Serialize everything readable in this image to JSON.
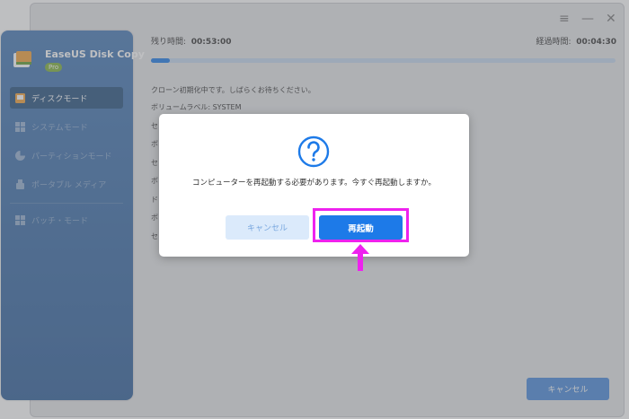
{
  "app": {
    "name": "EaseUS Disk Copy",
    "edition": "Pro"
  },
  "window_controls": {
    "menu": "≡",
    "minimize": "—",
    "close": "✕"
  },
  "sidebar": {
    "items": [
      {
        "label": "ディスクモード",
        "active": true,
        "icon": "disk-icon"
      },
      {
        "label": "システムモード",
        "active": false,
        "icon": "windows-icon"
      },
      {
        "label": "パーティションモード",
        "active": false,
        "icon": "pie-icon"
      },
      {
        "label": "ポータブル メディア",
        "active": false,
        "icon": "usb-icon"
      },
      {
        "label": "バッチ・モード",
        "active": false,
        "icon": "batch-icon"
      }
    ]
  },
  "status": {
    "time_left_label": "残り時間:",
    "time_left": "00:53:00",
    "elapsed_label": "経過時間:",
    "elapsed": "00:04:30",
    "progress_fraction": 0.04
  },
  "log": [
    "クローン初期化中です。しばらくお待ちください。",
    "ボリュームラベル: SYSTEM",
    "セ",
    "ボ",
    "セ",
    "ボ",
    "ド",
    "ボ",
    "セ"
  ],
  "bottom": {
    "cancel_label": "キャンセル"
  },
  "dialog": {
    "icon": "question-icon",
    "message": "コンピューターを再起動する必要があります。今すぐ再起動しますか。",
    "cancel_label": "キャンセル",
    "restart_label": "再起動"
  },
  "colors": {
    "accent": "#1d7ae8",
    "sidebar": "#3a6ba8",
    "highlight": "#ee22ee"
  }
}
